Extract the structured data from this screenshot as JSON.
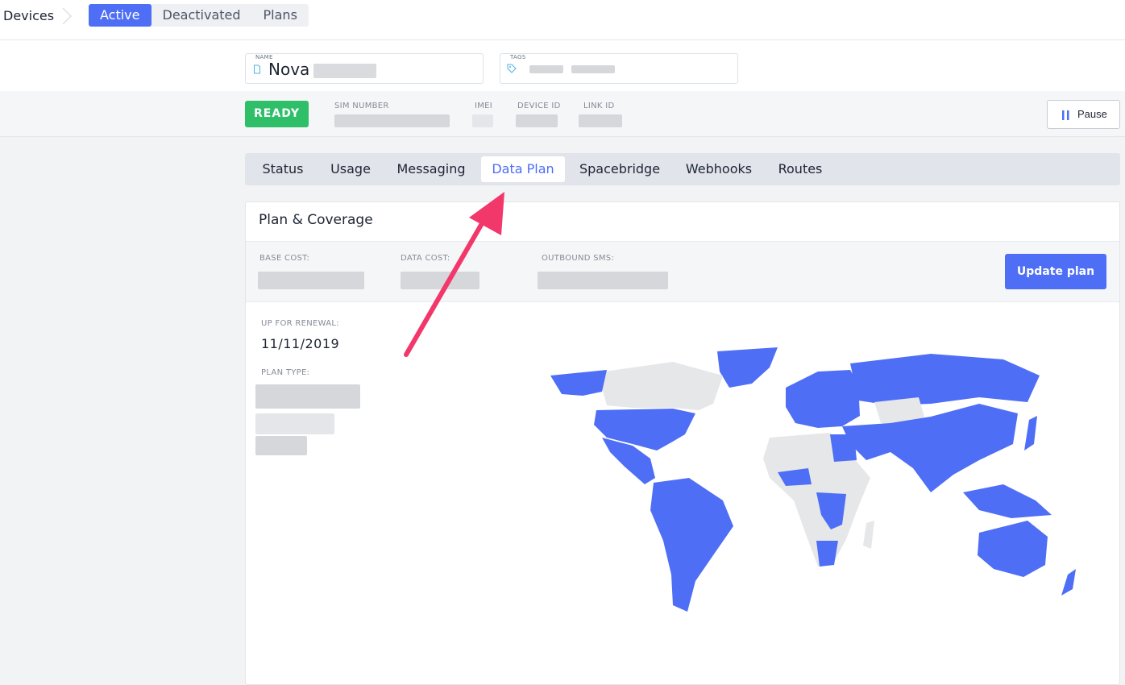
{
  "nav": {
    "breadcrumb": "Devices",
    "tabs": [
      {
        "label": "Active",
        "active": true
      },
      {
        "label": "Deactivated",
        "active": false
      },
      {
        "label": "Plans",
        "active": false
      }
    ]
  },
  "device": {
    "name_label": "NAME",
    "name_value": "Nova",
    "tags_label": "TAGS",
    "status": "READY",
    "meta_labels": {
      "sim": "SIM NUMBER",
      "imei": "IMEI",
      "device_id": "DEVICE ID",
      "link_id": "LINK ID"
    },
    "pause_label": "Pause"
  },
  "tabs": [
    {
      "label": "Status",
      "active": false
    },
    {
      "label": "Usage",
      "active": false
    },
    {
      "label": "Messaging",
      "active": false
    },
    {
      "label": "Data Plan",
      "active": true
    },
    {
      "label": "Spacebridge",
      "active": false
    },
    {
      "label": "Webhooks",
      "active": false
    },
    {
      "label": "Routes",
      "active": false
    }
  ],
  "plan": {
    "title": "Plan & Coverage",
    "base_cost_label": "BASE COST:",
    "data_cost_label": "DATA COST:",
    "sms_label": "OUTBOUND SMS:",
    "update_button": "Update plan",
    "renewal_label": "UP FOR RENEWAL:",
    "renewal_value": "11/11/2019",
    "plan_type_label": "PLAN TYPE:"
  },
  "colors": {
    "accent": "#4e6ef5",
    "ready": "#2fbf69",
    "coverage": "#4e6ef5",
    "no_coverage": "#e6e7e9",
    "annotation_arrow": "#f2386b"
  }
}
